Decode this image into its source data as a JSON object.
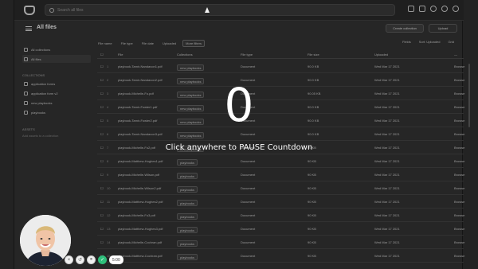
{
  "search": {
    "placeholder": "Search all files"
  },
  "header": {
    "title": "All files",
    "create_collection": "Create collection",
    "upload": "Upload"
  },
  "filters": [
    "File name",
    "File type",
    "File date",
    "Uploaded",
    "More filters"
  ],
  "filters_right": [
    "Fields",
    "Sort: Uploaded",
    "Grid"
  ],
  "sidebar": {
    "top_items": [
      {
        "label": "All collections",
        "icon": "grid-icon"
      },
      {
        "label": "All files",
        "icon": "file-icon",
        "active": true
      }
    ],
    "collections_heading": "COLLECTIONS",
    "collections": [
      "application forms",
      "application form v2",
      "new playbooks",
      "playbooks"
    ],
    "assets_heading": "ASSETS",
    "assets_note": "Add assets to a collection"
  },
  "table": {
    "columns": [
      "File",
      "Collections",
      "File type",
      "File size",
      "Uploaded",
      "—"
    ],
    "rows": [
      {
        "num": "1",
        "file": "playbook-Tamir-Nandavon1.pdf",
        "col": "new playbooks",
        "type": "Document",
        "size": "90.0 KB",
        "date": "Wed Mar 17 2021",
        "extra": "Browse"
      },
      {
        "num": "2",
        "file": "playbook-Tamir-Nandavon2.pdf",
        "col": "new playbooks",
        "type": "Document",
        "size": "90.0 KB",
        "date": "Wed Mar 17 2021",
        "extra": "Browse"
      },
      {
        "num": "3",
        "file": "playbook-Michelle-Fu.pdf",
        "col": "new playbooks",
        "type": "Document",
        "size": "90.05 KB",
        "date": "Wed Mar 17 2021",
        "extra": "Browse"
      },
      {
        "num": "4",
        "file": "playbook-Tamir-Fowler1.pdf",
        "col": "new playbooks",
        "type": "Document",
        "size": "90.0 KB",
        "date": "Wed Mar 17 2021",
        "extra": "Browse"
      },
      {
        "num": "5",
        "file": "playbook-Tamir-Fowler2.pdf",
        "col": "new playbooks",
        "type": "Document",
        "size": "90.0 KB",
        "date": "Wed Mar 17 2021",
        "extra": "Browse"
      },
      {
        "num": "6",
        "file": "playbook-Tamir-Nandavon3.pdf",
        "col": "new playbooks",
        "type": "Document",
        "size": "90.0 KB",
        "date": "Wed Mar 17 2021",
        "extra": "Browse"
      },
      {
        "num": "7",
        "file": "playbook-Michelle-Fu2.pdf",
        "col": "new playbooks",
        "type": "Document",
        "size": "90 KB",
        "date": "Wed Mar 17 2021",
        "extra": "Browse"
      },
      {
        "num": "8",
        "file": "playbook-Matthew-Hughes1.pdf",
        "col": "playbooks",
        "type": "Document",
        "size": "90 KB",
        "date": "Wed Mar 17 2021",
        "extra": "Browse"
      },
      {
        "num": "9",
        "file": "playbook-Michelle-Wilson.pdf",
        "col": "playbooks",
        "type": "Document",
        "size": "90 KB",
        "date": "Wed Mar 17 2021",
        "extra": "Browse"
      },
      {
        "num": "10",
        "file": "playbook-Michelle-Wilson2.pdf",
        "col": "playbooks",
        "type": "Document",
        "size": "90 KB",
        "date": "Wed Mar 17 2021",
        "extra": "Browse"
      },
      {
        "num": "11",
        "file": "playbook-Matthew-Hughes2.pdf",
        "col": "playbooks",
        "type": "Document",
        "size": "90 KB",
        "date": "Wed Mar 17 2021",
        "extra": "Browse"
      },
      {
        "num": "12",
        "file": "playbook-Michelle-Fu3.pdf",
        "col": "playbooks",
        "type": "Document",
        "size": "90 KB",
        "date": "Wed Mar 17 2021",
        "extra": "Browse"
      },
      {
        "num": "13",
        "file": "playbook-Matthew-Hughes3.pdf",
        "col": "playbooks",
        "type": "Document",
        "size": "90 KB",
        "date": "Wed Mar 17 2021",
        "extra": "Browse"
      },
      {
        "num": "14",
        "file": "playbook-Michelle-Cochran.pdf",
        "col": "playbooks",
        "type": "Document",
        "size": "90 KB",
        "date": "Wed Mar 17 2021",
        "extra": "Browse"
      },
      {
        "num": "15",
        "file": "playbook-Matthew-Cochran.pdf",
        "col": "playbooks",
        "type": "Document",
        "size": "90 KB",
        "date": "Wed Mar 17 2021",
        "extra": "Browse"
      }
    ]
  },
  "overlay": {
    "count": "0",
    "message": "Click anywhere to PAUSE Countdown"
  },
  "recorder": {
    "timer": "5:00"
  },
  "colors": {
    "overlay_text": "#ffffff",
    "record_green": "#2fbf7b",
    "background": "#2f2f2f"
  }
}
